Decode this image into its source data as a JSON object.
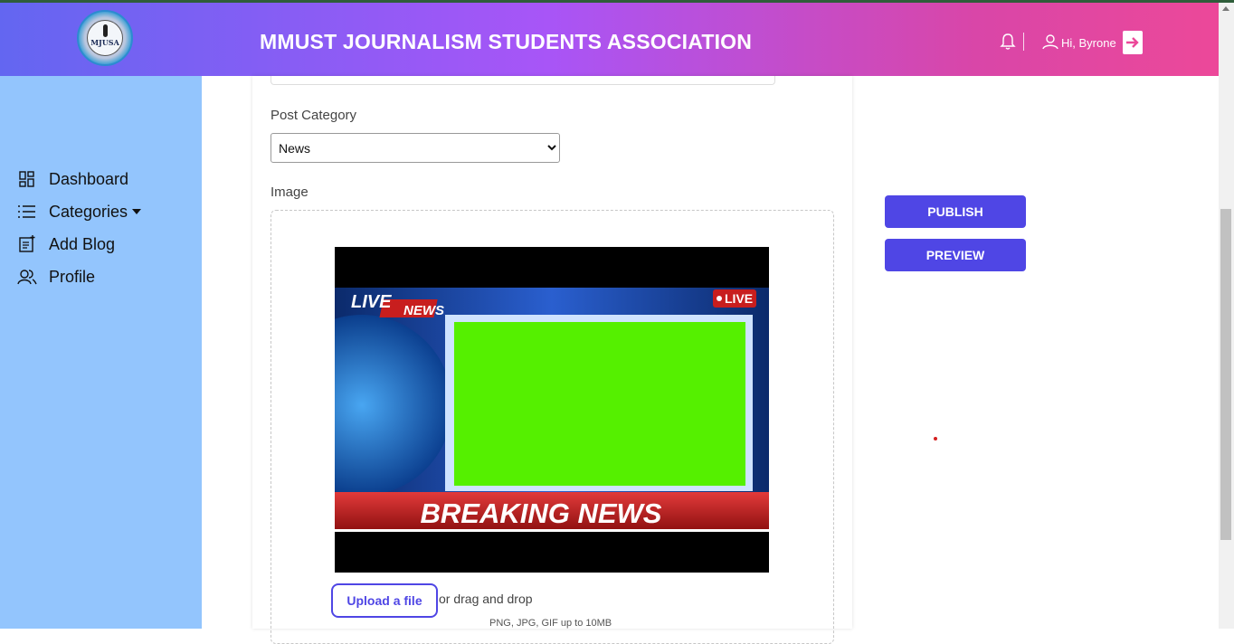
{
  "header": {
    "title": "MMUST JOURNALISM STUDENTS ASSOCIATION",
    "logo_text": "MJUSA",
    "greeting": "Hi, Byrone"
  },
  "sidebar": {
    "items": [
      {
        "label": "Dashboard",
        "icon": "dashboard-icon"
      },
      {
        "label": "Categories",
        "icon": "list-icon"
      },
      {
        "label": "Add Blog",
        "icon": "add-blog-icon"
      },
      {
        "label": "Profile",
        "icon": "users-icon"
      }
    ]
  },
  "form": {
    "category_label": "Post Category",
    "category_value": "News",
    "category_options": [
      "News"
    ],
    "image_label": "Image",
    "upload_label": "Upload a file",
    "drag_text": "or drag and drop",
    "file_hint": "PNG, JPG, GIF up to 10MB"
  },
  "preview_image": {
    "live_tag": "LIVE",
    "news_tag": "NEWS",
    "live_badge": "LIVE",
    "headline": "BREAKING NEWS"
  },
  "actions": {
    "publish_label": "PUBLISH",
    "preview_label": "PREVIEW"
  },
  "colors": {
    "accent": "#4f46e5",
    "sidebar": "#93c5fd",
    "header_start": "#6366f1",
    "header_end": "#ec4899"
  }
}
